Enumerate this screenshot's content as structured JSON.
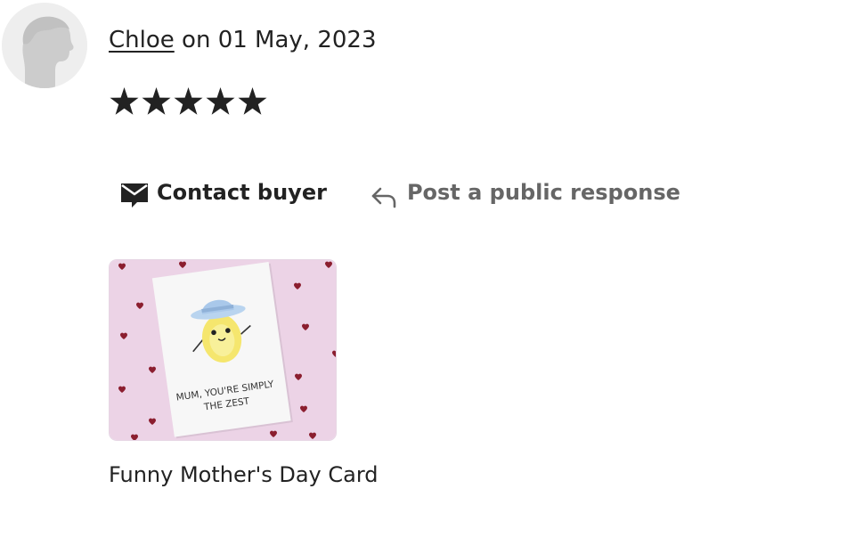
{
  "review": {
    "reviewer_name": "Chloe",
    "date_prefix": " on ",
    "date": "01 May, 2023",
    "rating": 5,
    "rating_max": 5
  },
  "actions": {
    "contact_label": "Contact buyer",
    "contact_icon": "envelope-icon",
    "response_label": "Post a public response",
    "response_icon": "reply-arrow-icon"
  },
  "product": {
    "title": "Funny Mother's Day Card",
    "card_text_line1": "MUM, YOU'RE SIMPLY",
    "card_text_line2": "THE ZEST"
  },
  "colors": {
    "text": "#222222",
    "muted": "#666666",
    "product_background": "#ecd3e6",
    "heart": "#8b1e2f"
  }
}
